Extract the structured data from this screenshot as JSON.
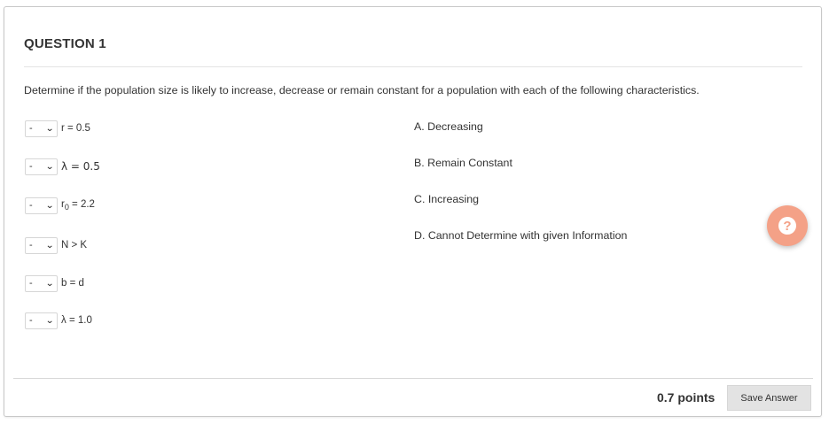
{
  "question": {
    "title": "QUESTION 1",
    "prompt": "Determine if the population size is likely to increase, decrease or remain constant for a population with each of the following characteristics."
  },
  "items": [
    {
      "selected": "-",
      "label": "r = 0.5"
    },
    {
      "selected": "-",
      "label": "λ = 0.5"
    },
    {
      "selected": "-",
      "label_main": "r",
      "label_sub": "0",
      "label_rest": " = 2.2"
    },
    {
      "selected": "-",
      "label": "N > K"
    },
    {
      "selected": "-",
      "label": "b = d"
    },
    {
      "selected": "-",
      "label": "λ = 1.0"
    }
  ],
  "answers": [
    "A. Decreasing",
    "B. Remain Constant",
    "C. Increasing",
    "D. Cannot Determine with given Information"
  ],
  "footer": {
    "points": "0.7 points",
    "save_label": "Save Answer"
  },
  "help": {
    "icon": "question-mark-icon",
    "glyph": "?",
    "color": "#f4a187"
  }
}
